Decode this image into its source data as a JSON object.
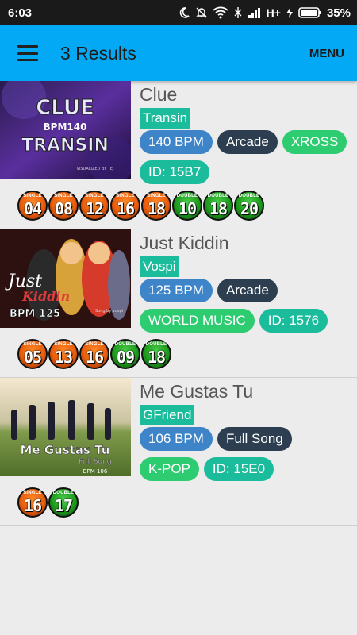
{
  "statusbar": {
    "time": "6:03",
    "network": "H+",
    "battery": "35%"
  },
  "appbar": {
    "title": "3 Results",
    "menu_label": "MENU"
  },
  "songs": [
    {
      "title": "Clue",
      "artist": "Transin",
      "tags": [
        {
          "label": "140 BPM",
          "kind": "bpm"
        },
        {
          "label": "Arcade",
          "kind": "dark"
        },
        {
          "label": "XROSS",
          "kind": "green"
        },
        {
          "label": "ID: 15B7",
          "kind": "teal"
        }
      ],
      "thumb": {
        "line1": "CLUE",
        "line2": "BPM140",
        "line3": "TRANSIN",
        "line4": "VISUALIZED BY TEJ"
      },
      "levels": [
        {
          "type": "single",
          "label": "SINGLE",
          "value": "04"
        },
        {
          "type": "single",
          "label": "SINGLE",
          "value": "08"
        },
        {
          "type": "single",
          "label": "SINGLE",
          "value": "12"
        },
        {
          "type": "single",
          "label": "SINGLE",
          "value": "16"
        },
        {
          "type": "single",
          "label": "SINGLE",
          "value": "18"
        },
        {
          "type": "double",
          "label": "DOUBLE",
          "value": "10"
        },
        {
          "type": "double",
          "label": "DOUBLE",
          "value": "18"
        },
        {
          "type": "double",
          "label": "DOUBLE",
          "value": "20"
        }
      ]
    },
    {
      "title": "Just Kiddin",
      "artist": "Vospi",
      "tags": [
        {
          "label": "125 BPM",
          "kind": "bpm"
        },
        {
          "label": "Arcade",
          "kind": "dark"
        },
        {
          "label": "WORLD MUSIC",
          "kind": "green"
        },
        {
          "label": "ID: 1576",
          "kind": "teal"
        }
      ],
      "thumb": {
        "line1": "Just",
        "line2": "Kiddin",
        "line3": "BPM 125",
        "line4": "Song by vospi"
      },
      "levels": [
        {
          "type": "single",
          "label": "SINGLE",
          "value": "05"
        },
        {
          "type": "single",
          "label": "SINGLE",
          "value": "13"
        },
        {
          "type": "single",
          "label": "SINGLE",
          "value": "16"
        },
        {
          "type": "double",
          "label": "DOUBLE",
          "value": "09"
        },
        {
          "type": "double",
          "label": "DOUBLE",
          "value": "18"
        }
      ]
    },
    {
      "title": "Me Gustas Tu",
      "artist": "GFriend",
      "tags": [
        {
          "label": "106 BPM",
          "kind": "bpm"
        },
        {
          "label": "Full Song",
          "kind": "dark"
        },
        {
          "label": "K-POP",
          "kind": "green"
        },
        {
          "label": "ID: 15E0",
          "kind": "teal"
        }
      ],
      "thumb": {
        "line1": "Me Gustas Tu",
        "line2": "Full Song",
        "line3": "BPM 106",
        "line4": ""
      },
      "levels": [
        {
          "type": "single",
          "label": "SINGLE",
          "value": "16"
        },
        {
          "type": "double",
          "label": "DOUBLE",
          "value": "17"
        }
      ]
    }
  ]
}
